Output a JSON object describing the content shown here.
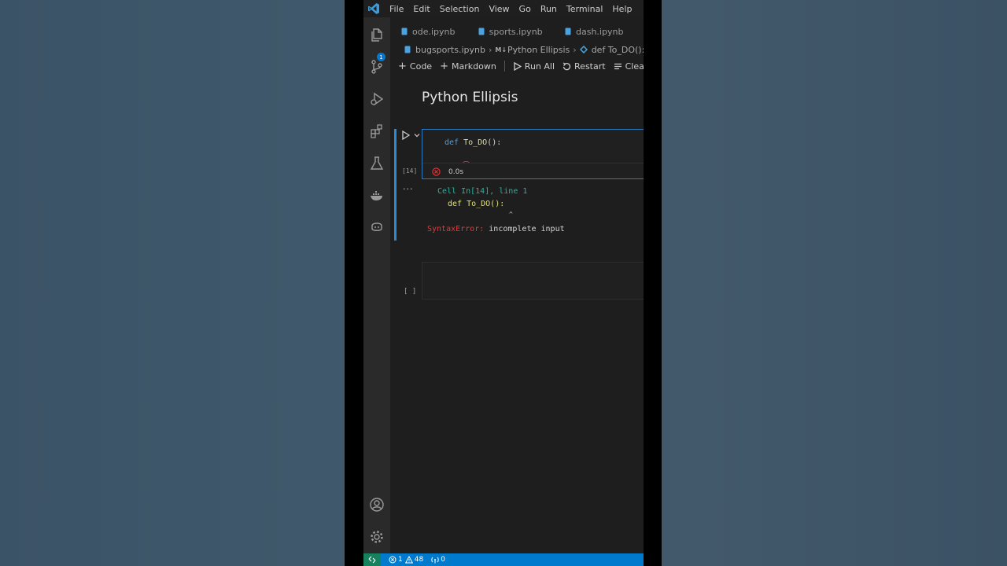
{
  "menu": {
    "items": [
      "File",
      "Edit",
      "Selection",
      "View",
      "Go",
      "Run",
      "Terminal",
      "Help"
    ]
  },
  "activity_bar": {
    "icons": [
      "explorer-icon",
      "source-control-icon",
      "run-debug-icon",
      "extensions-icon",
      "testing-icon",
      "docker-icon",
      "copilot-icon",
      "account-icon",
      "settings-icon"
    ],
    "explorer_badge": "1"
  },
  "tabs": [
    {
      "label": "ode.ipynb"
    },
    {
      "label": "sports.ipynb"
    },
    {
      "label": "dash.ipynb"
    }
  ],
  "breadcrumb": {
    "file": "bugsports.ipynb",
    "markdown_tag": "M↓",
    "section": "Python Ellipsis",
    "symbol": "def To_DO():"
  },
  "toolbar": {
    "code": "Code",
    "markdown": "Markdown",
    "run_all": "Run All",
    "restart": "Restart",
    "clear": "Clea"
  },
  "notebook": {
    "heading": "Python Ellipsis",
    "cell": {
      "keyword": "def",
      "func": "To_DO",
      "punct": "():",
      "execution_count": "[14]",
      "duration": "0.0s",
      "output_more": "···"
    },
    "output": {
      "location": "Cell In[14], line 1",
      "source": "def To_DO():",
      "caret": "^",
      "error_name": "SyntaxError:",
      "error_message": "incomplete input"
    },
    "empty_cell_count": "[ ]"
  },
  "statusbar": {
    "errors": "1",
    "warnings": "48",
    "ports": "0"
  },
  "colors": {
    "accent": "#007acc",
    "remote": "#16825d",
    "error": "#e23a3a",
    "cell_focus": "#2b8ad6"
  }
}
